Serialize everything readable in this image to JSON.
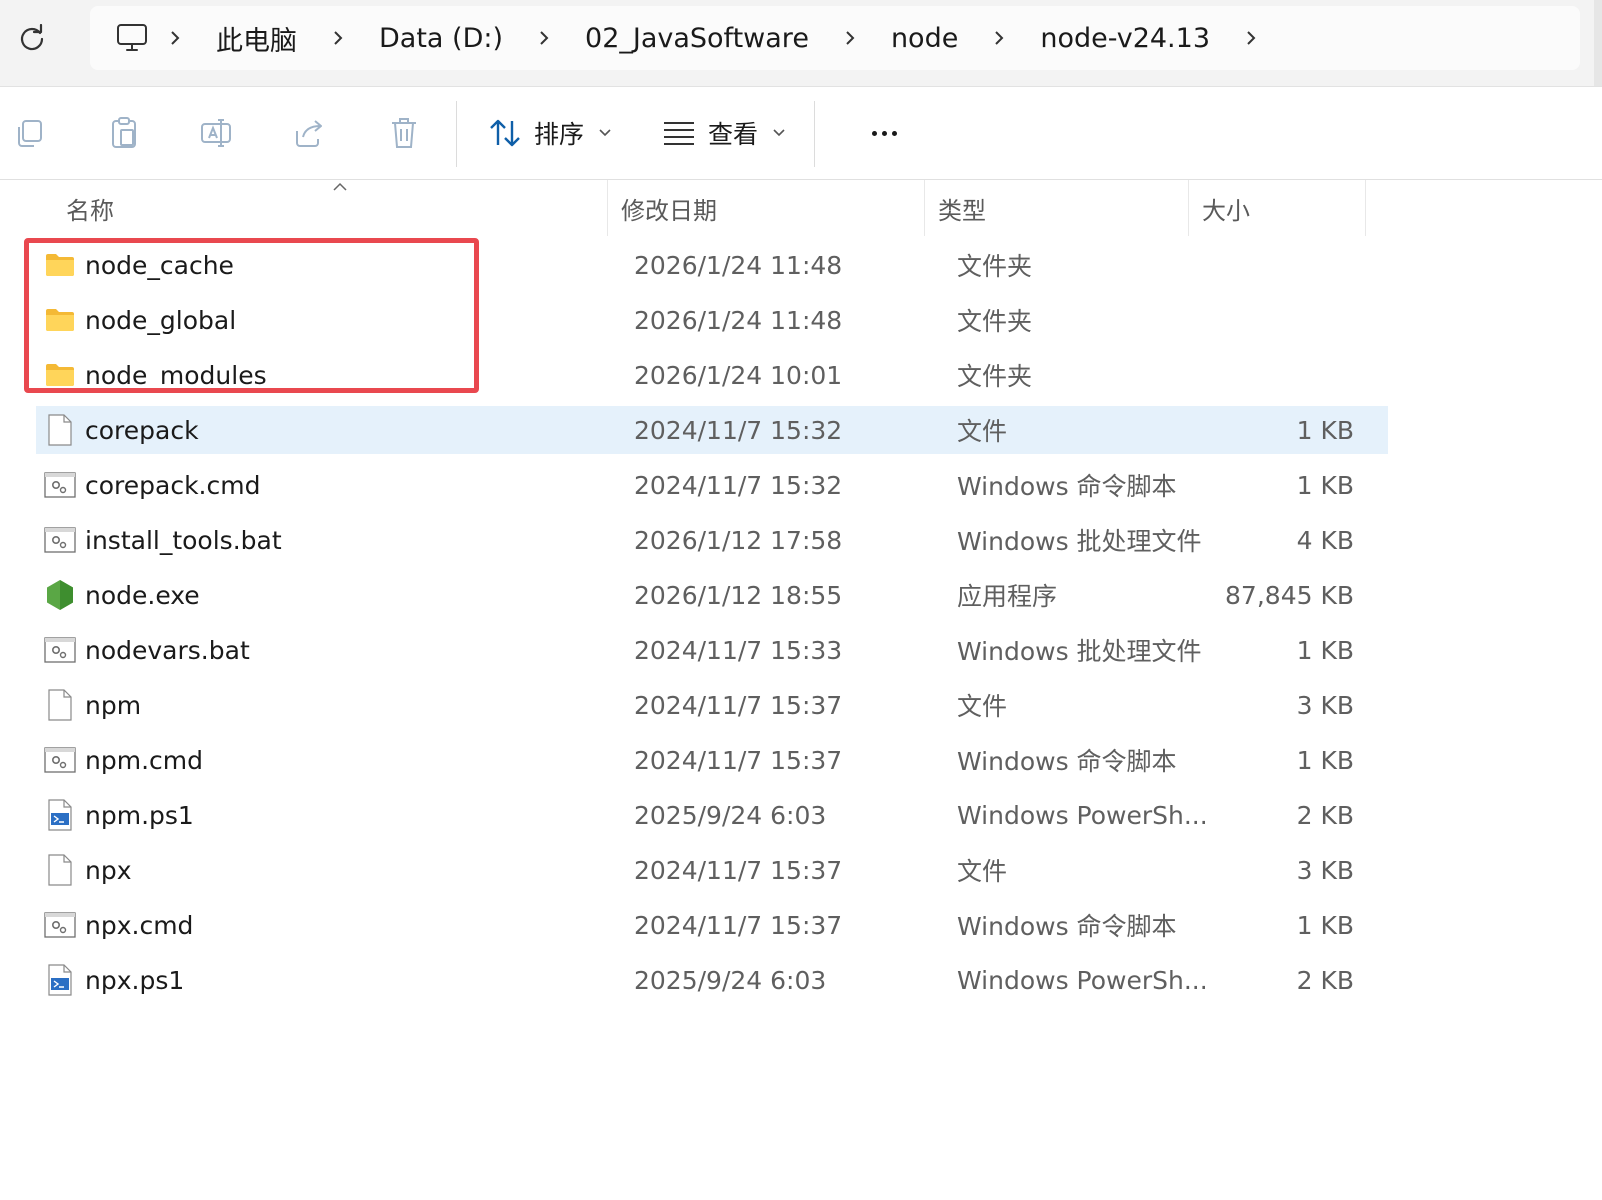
{
  "breadcrumb": {
    "items": [
      "此电脑",
      "Data (D:)",
      "02_JavaSoftware",
      "node",
      "node-v24.13"
    ]
  },
  "toolbar": {
    "sort_label": "排序",
    "view_label": "查看"
  },
  "columns": {
    "name": "名称",
    "date": "修改日期",
    "type": "类型",
    "size": "大小"
  },
  "files": [
    {
      "name": "node_cache",
      "date": "2026/1/24 11:48",
      "type": "文件夹",
      "size": "",
      "icon": "folder-icon"
    },
    {
      "name": "node_global",
      "date": "2026/1/24 11:48",
      "type": "文件夹",
      "size": "",
      "icon": "folder-icon"
    },
    {
      "name": "node_modules",
      "date": "2026/1/24 10:01",
      "type": "文件夹",
      "size": "",
      "icon": "folder-icon"
    },
    {
      "name": "corepack",
      "date": "2024/11/7 15:32",
      "type": "文件",
      "size": "1 KB",
      "icon": "file-icon"
    },
    {
      "name": "corepack.cmd",
      "date": "2024/11/7 15:32",
      "type": "Windows 命令脚本",
      "size": "1 KB",
      "icon": "script-icon"
    },
    {
      "name": "install_tools.bat",
      "date": "2026/1/12 17:58",
      "type": "Windows 批处理文件",
      "size": "4 KB",
      "icon": "script-icon"
    },
    {
      "name": "node.exe",
      "date": "2026/1/12 18:55",
      "type": "应用程序",
      "size": "87,845 KB",
      "icon": "node-exe-icon"
    },
    {
      "name": "nodevars.bat",
      "date": "2024/11/7 15:33",
      "type": "Windows 批处理文件",
      "size": "1 KB",
      "icon": "script-icon"
    },
    {
      "name": "npm",
      "date": "2024/11/7 15:37",
      "type": "文件",
      "size": "3 KB",
      "icon": "file-icon"
    },
    {
      "name": "npm.cmd",
      "date": "2024/11/7 15:37",
      "type": "Windows 命令脚本",
      "size": "1 KB",
      "icon": "script-icon"
    },
    {
      "name": "npm.ps1",
      "date": "2025/9/24 6:03",
      "type": "Windows PowerSh...",
      "size": "2 KB",
      "icon": "powershell-icon"
    },
    {
      "name": "npx",
      "date": "2024/11/7 15:37",
      "type": "文件",
      "size": "3 KB",
      "icon": "file-icon"
    },
    {
      "name": "npx.cmd",
      "date": "2024/11/7 15:37",
      "type": "Windows 命令脚本",
      "size": "1 KB",
      "icon": "script-icon"
    },
    {
      "name": "npx.ps1",
      "date": "2025/9/24 6:03",
      "type": "Windows PowerSh...",
      "size": "2 KB",
      "icon": "powershell-icon"
    }
  ],
  "selected_file": "corepack",
  "colors": {
    "accent": "#0067c0",
    "selection": "#e5f1fb",
    "highlight_box": "#e9484f",
    "folder": "#f8c948"
  }
}
